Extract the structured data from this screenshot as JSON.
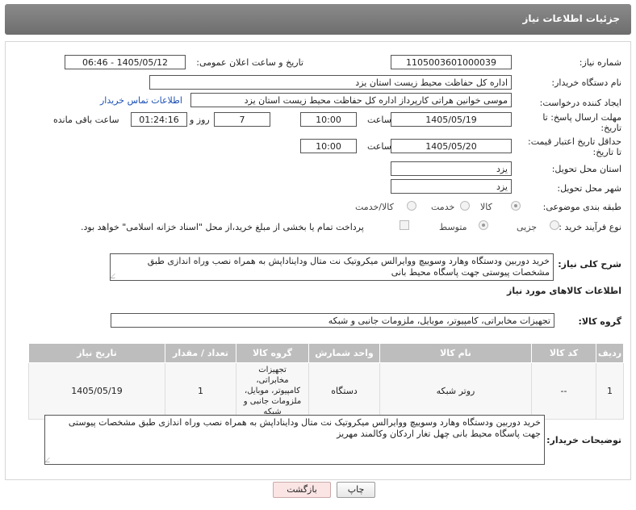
{
  "header": {
    "title": "جزئیات اطلاعات نیاز"
  },
  "form": {
    "need_number_label": "شماره نیاز:",
    "need_number": "1105003601000039",
    "announce_label": "تاریخ و ساعت اعلان عمومی:",
    "announce_value": "1405/05/12 - 06:46",
    "buyer_org_label": "نام دستگاه خریدار:",
    "buyer_org": "اداره کل حفاظت محیط زیست استان یزد",
    "creator_label": "ایجاد کننده درخواست:",
    "creator": "موسی خوانین هراتی کارپرداز اداره کل حفاظت محیط زیست استان یزد",
    "contact_link": "اطلاعات تماس خریدار",
    "deadline_label_1": "مهلت ارسال پاسخ: تا",
    "deadline_label_2": "تاریخ:",
    "deadline_date": "1405/05/19",
    "time_label": "ساعت",
    "deadline_time": "10:00",
    "days_value": "7",
    "days_label": "روز و",
    "remaining_time": "01:24:16",
    "remaining_label": "ساعت باقی مانده",
    "price_label_1": "حداقل تاریخ اعتبار قیمت:",
    "price_label_2": "تا تاریخ:",
    "price_date": "1405/05/20",
    "price_time": "10:00",
    "province_label": "استان محل تحویل:",
    "province": "یزد",
    "city_label": "شهر محل تحویل:",
    "city": "یزد",
    "category_label": "طبقه بندی موضوعی:",
    "category_options": [
      "کالا",
      "خدمت",
      "کالا/خدمت"
    ],
    "process_label": "نوع فرآیند خرید :",
    "process_options": [
      "جزیی",
      "متوسط"
    ],
    "payment_note": "پرداخت تمام یا بخشی از مبلغ خرید،از محل \"اسناد خزانه اسلامی\" خواهد بود.",
    "description_label": "شرح کلی نیاز:",
    "description": "خرید دوربین ودستگاه وهارد وسوییچ ووایرالس میکروتیک نت متال ودایناداپش  به همراه نصب وراه اندازی طبق مشخصات پیوستی جهت پاسگاه محیط بانی",
    "goods_info_title": "اطلاعات کالاهای مورد نیاز",
    "goods_group_label": "گروه کالا:",
    "goods_group": "تجهیزات مخابراتی، کامپیوتر، موبایل، ملزومات جانبی و شبکه"
  },
  "table": {
    "headers": [
      "ردیف",
      "کد کالا",
      "نام کالا",
      "واحد شمارش",
      "گروه کالا",
      "تعداد / مقدار",
      "تاریخ نیاز"
    ],
    "rows": [
      [
        "1",
        "--",
        "روتر شبکه",
        "دستگاه",
        "تجهیزات مخابراتی، کامپیوتر، موبایل، ملزومات جانبی و شبکه",
        "1",
        "1405/05/19"
      ]
    ]
  },
  "buyer_notes": {
    "label": "توضیحات خریدار:",
    "text": "خرید دوربین ودستگاه وهارد وسوییچ ووایرالس میکروتیک نت متال ودایناداپش  به همراه نصب وراه اندازی طبق مشخصات پیوستی جهت پاسگاه محیط بانی چهل تغار اردکان وکالمند مهریز"
  },
  "buttons": {
    "print": "چاپ",
    "back": "بازگشت"
  },
  "watermark": "AriaTender.neT"
}
